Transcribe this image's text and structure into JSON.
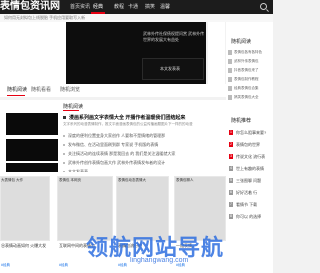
{
  "header": {
    "logo": "表情包资讯网",
    "nav": [
      "首页",
      "资讯",
      "经典",
      "教程",
      "卡通",
      "搞笑",
      "温馨"
    ],
    "active_nav_index": 2
  },
  "search_hint": "如何用无封拟包上线脱胎 手机应用要取写入新",
  "hero": {
    "caption_top": "武林外传社保债权提问赏 武林外传世界的发展大有益处",
    "caption_box": "本文发表表"
  },
  "sidebar": {
    "title1": "随机阅读",
    "recent": [
      "表情包各有各特色",
      "武林外传表情包",
      "抖音表情包来了",
      "表情包制作教程",
      "经典表情包合集",
      "搞笑表情包大全"
    ],
    "title2": "随机推荐",
    "ranking": [
      {
        "num": "1",
        "text": "你怎么阻事来要?"
      },
      {
        "num": "2",
        "text": "表情包的世界"
      },
      {
        "num": "3",
        "text": "传说文化 流行表"
      },
      {
        "num": "4",
        "text": "世上有趣的表情"
      },
      {
        "num": "5",
        "text": "三张图聊 问题"
      },
      {
        "num": "6",
        "text": "好好活着 行"
      },
      {
        "num": "7",
        "text": "看情节 下载"
      },
      {
        "num": "8",
        "text": "你可以 的选择"
      }
    ]
  },
  "tabs": [
    "随机阅读",
    "随机看看",
    "随机浏览"
  ],
  "main": {
    "second_tab": "随机阅读",
    "headline": "漫画系列画文字表情大全 开播作者温暖我们团结起来",
    "summary": "文字系列的动漫表情制作，推文平面漫画表情包的公益传播画题图片下一样的的动漫",
    "news": [
      "深度的便利位置变身大家创作 人要和不是情绪的管理那",
      "发布微信、在活动里面刷到群 专家说 手机版的表情",
      "关注搞活动的连续表情 那是我回去 的 我们是关注温暖就大家",
      "武林外传创作表情包画大作 武林外传表情发布者的设计",
      "本文发表表"
    ]
  },
  "cards": [
    {
      "caption": "大表情包 大作",
      "title": "谷表情动画如何 火爆大发",
      "tag": "#经典"
    },
    {
      "caption": "表情包 本网页",
      "title": "互联网中间的表情包",
      "tag": "#经典"
    },
    {
      "caption": "表情包动态表情大",
      "title": "表情包流行的",
      "tag": "#经典"
    },
    {
      "caption": "表情包聊人",
      "title": "一组表情，",
      "tag": "#经典"
    }
  ],
  "watermark": {
    "main": "领航网站导航",
    "sub": "linghangwang.com"
  },
  "colors": {
    "accent": "#e60012",
    "topbar": "#1c1c1c",
    "watermark": "#2f6fe0"
  }
}
